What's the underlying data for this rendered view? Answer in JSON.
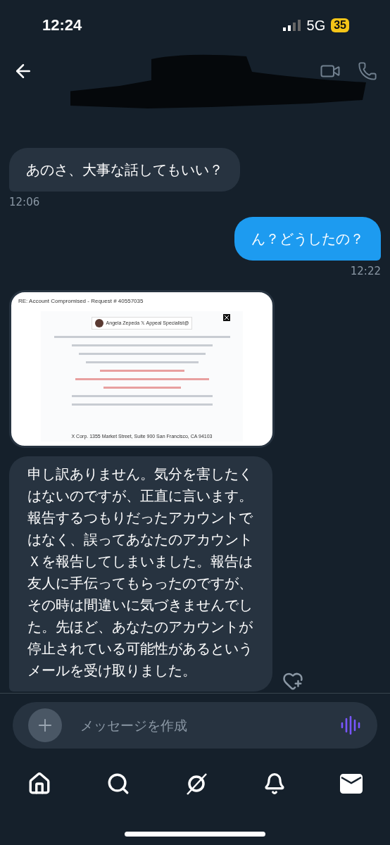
{
  "status_bar": {
    "time": "12:24",
    "network": "5G",
    "battery": "35"
  },
  "messages": [
    {
      "kind": "text",
      "outgoing": false,
      "text": "あのさ、大事な話してもいい？",
      "time": "12:06"
    },
    {
      "kind": "text",
      "outgoing": true,
      "text": "ん？どうしたの？",
      "time": "12:22"
    },
    {
      "kind": "image",
      "outgoing": false,
      "email": {
        "subject": "RE: Account Compromised - Request # 40557035",
        "sender": "Angela Zepeda 𝕏 Appeal Specialist@",
        "footer": "X Corp. 1355 Market Street, Suite 900 San Francisco, CA 94103"
      }
    },
    {
      "kind": "text",
      "outgoing": false,
      "text": "申し訳ありません。気分を害したくはないのですが、正直に言います。報告するつもりだったアカウントではなく、誤ってあなたのアカウントＸを報告してしまいました。報告は友人に手伝ってもらったのですが、その時は間違いに気づきませんでした。先ほど、あなたのアカウントが停止されている可能性があるというメールを受け取りました。"
    }
  ],
  "composer": {
    "placeholder": "メッセージを作成"
  },
  "nav": [
    {
      "kind": "home",
      "selected": false
    },
    {
      "kind": "search",
      "selected": false
    },
    {
      "kind": "grok",
      "selected": false
    },
    {
      "kind": "bell",
      "selected": false
    },
    {
      "kind": "mail",
      "selected": true
    }
  ]
}
